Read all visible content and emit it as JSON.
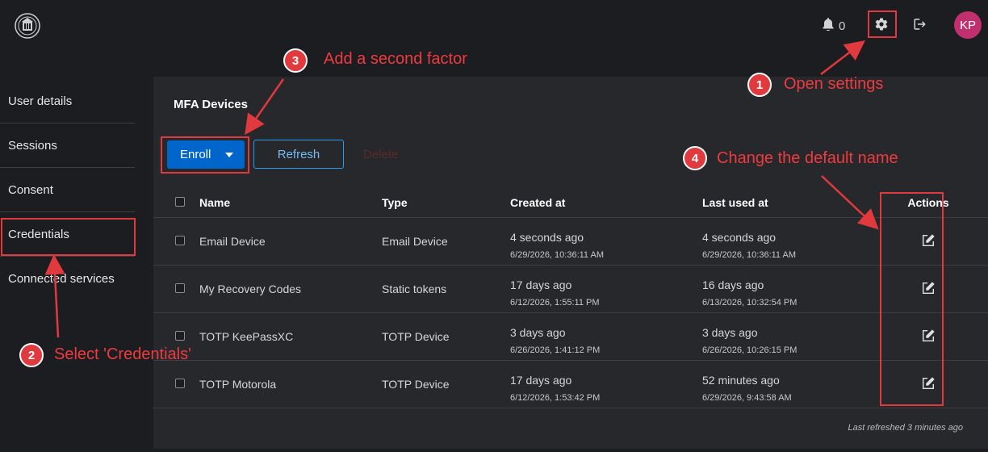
{
  "header": {
    "notification_count": "0",
    "avatar_initials": "KP",
    "logo_icon": "university-seal-icon",
    "bell_icon": "bell-icon",
    "settings_icon": "gear-icon",
    "logout_icon": "sign-out-icon"
  },
  "sidebar": {
    "items": [
      {
        "label": "User details"
      },
      {
        "label": "Sessions"
      },
      {
        "label": "Consent"
      },
      {
        "label": "Credentials"
      },
      {
        "label": "Connected services"
      }
    ]
  },
  "panel": {
    "title": "MFA Devices",
    "enroll_label": "Enroll",
    "refresh_label": "Refresh",
    "delete_label": "Delete",
    "columns": {
      "name": "Name",
      "type": "Type",
      "created": "Created at",
      "last_used": "Last used at",
      "actions": "Actions"
    },
    "rows": [
      {
        "name": "Email Device",
        "type": "Email Device",
        "created": "4 seconds ago",
        "created_full": "6/29/2026, 10:36:11 AM",
        "last_used": "4 seconds ago",
        "last_used_full": "6/29/2026, 10:36:11 AM"
      },
      {
        "name": "My Recovery Codes",
        "type": "Static tokens",
        "created": "17 days ago",
        "created_full": "6/12/2026, 1:55:11 PM",
        "last_used": "16 days ago",
        "last_used_full": "6/13/2026, 10:32:54 PM"
      },
      {
        "name": "TOTP KeePassXC",
        "type": "TOTP Device",
        "created": "3 days ago",
        "created_full": "6/26/2026, 1:41:12 PM",
        "last_used": "3 days ago",
        "last_used_full": "6/26/2026, 10:26:15 PM"
      },
      {
        "name": "TOTP Motorola",
        "type": "TOTP Device",
        "created": "17 days ago",
        "created_full": "6/12/2026, 1:53:42 PM",
        "last_used": "52 minutes ago",
        "last_used_full": "6/29/2026, 9:43:58 AM"
      }
    ],
    "last_refreshed": "Last refreshed 3 minutes ago"
  },
  "annotations": {
    "accent_color": "#e0393e",
    "steps": [
      {
        "number": "1",
        "text": "Open settings"
      },
      {
        "number": "2",
        "text": "Select 'Credentials'"
      },
      {
        "number": "3",
        "text": "Add a second factor"
      },
      {
        "number": "4",
        "text": "Change the default name"
      }
    ]
  }
}
